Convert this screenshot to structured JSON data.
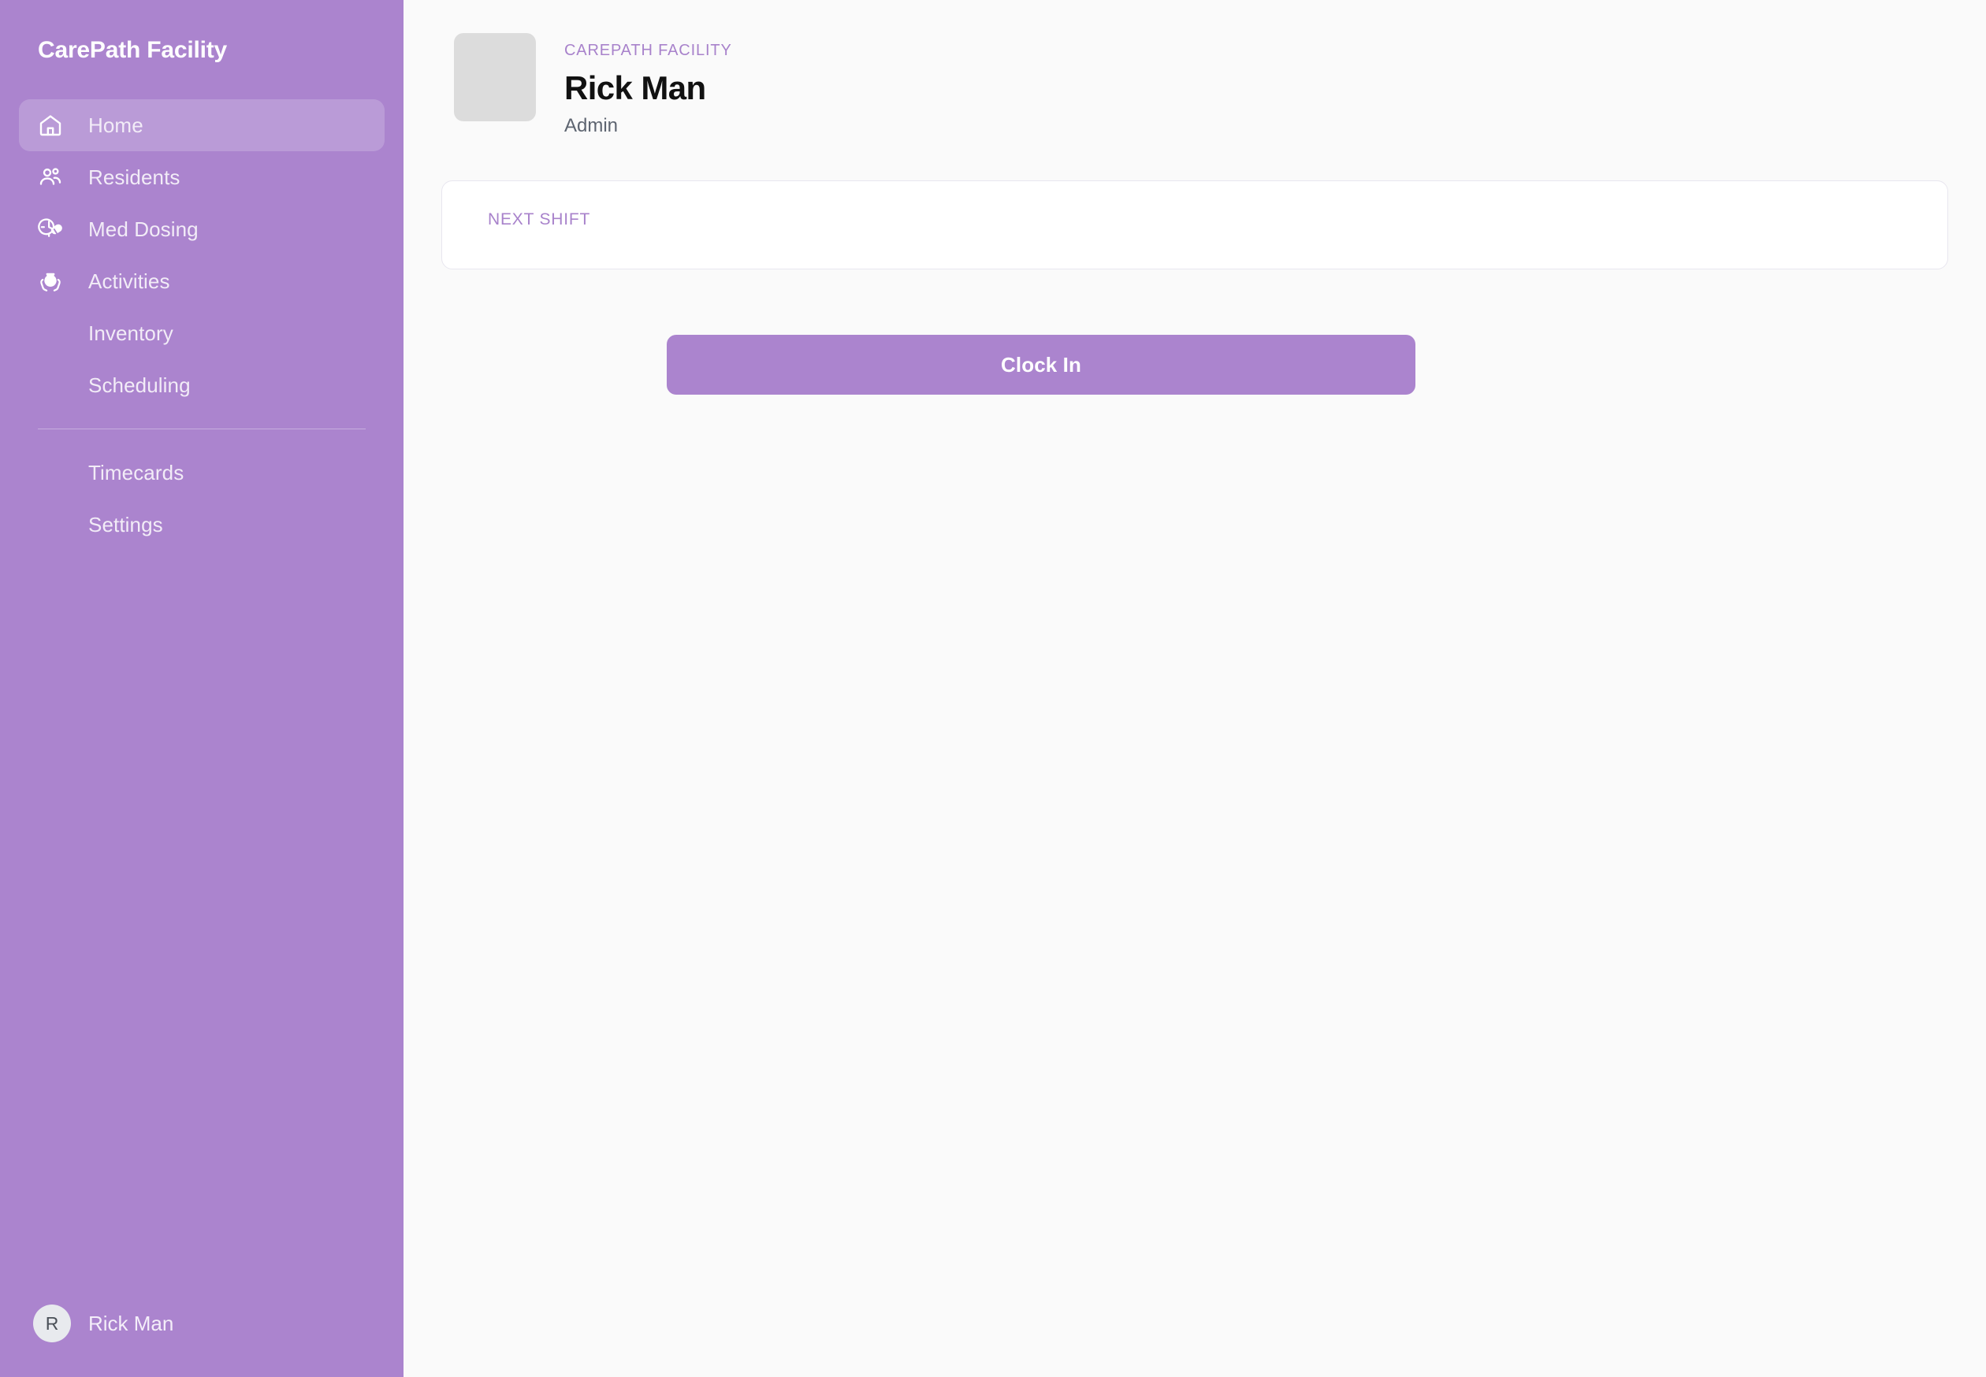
{
  "sidebar": {
    "title": "CarePath Facility",
    "items": [
      {
        "label": "Home",
        "icon": "home-icon",
        "active": true,
        "has_icon": true
      },
      {
        "label": "Residents",
        "icon": "users-icon",
        "active": false,
        "has_icon": true
      },
      {
        "label": "Med Dosing",
        "icon": "pill-clock-icon",
        "active": false,
        "has_icon": true
      },
      {
        "label": "Activities",
        "icon": "hands-pot-icon",
        "active": false,
        "has_icon": true
      },
      {
        "label": "Inventory",
        "icon": "",
        "active": false,
        "has_icon": false
      },
      {
        "label": "Scheduling",
        "icon": "",
        "active": false,
        "has_icon": false
      }
    ],
    "footer_items": [
      {
        "label": "Timecards",
        "icon": "",
        "active": false,
        "has_icon": false
      },
      {
        "label": "Settings",
        "icon": "",
        "active": false,
        "has_icon": false
      }
    ],
    "user": {
      "initial": "R",
      "name": "Rick Man"
    }
  },
  "header": {
    "eyebrow": "CAREPATH FACILITY",
    "name": "Rick Man",
    "role": "Admin",
    "photo_placeholder": "avatar-placeholder"
  },
  "shift_card": {
    "label": "NEXT SHIFT",
    "value": ""
  },
  "actions": {
    "clock_in_label": "Clock In"
  },
  "colors": {
    "brand_purple": "#ab84ce",
    "accent_text": "#a882cb",
    "page_background": "#fafafa",
    "card_background": "#ffffff",
    "card_border": "#e8e6ef",
    "photo_placeholder": "#dcdcdc",
    "avatar_background": "#e8eaee"
  }
}
